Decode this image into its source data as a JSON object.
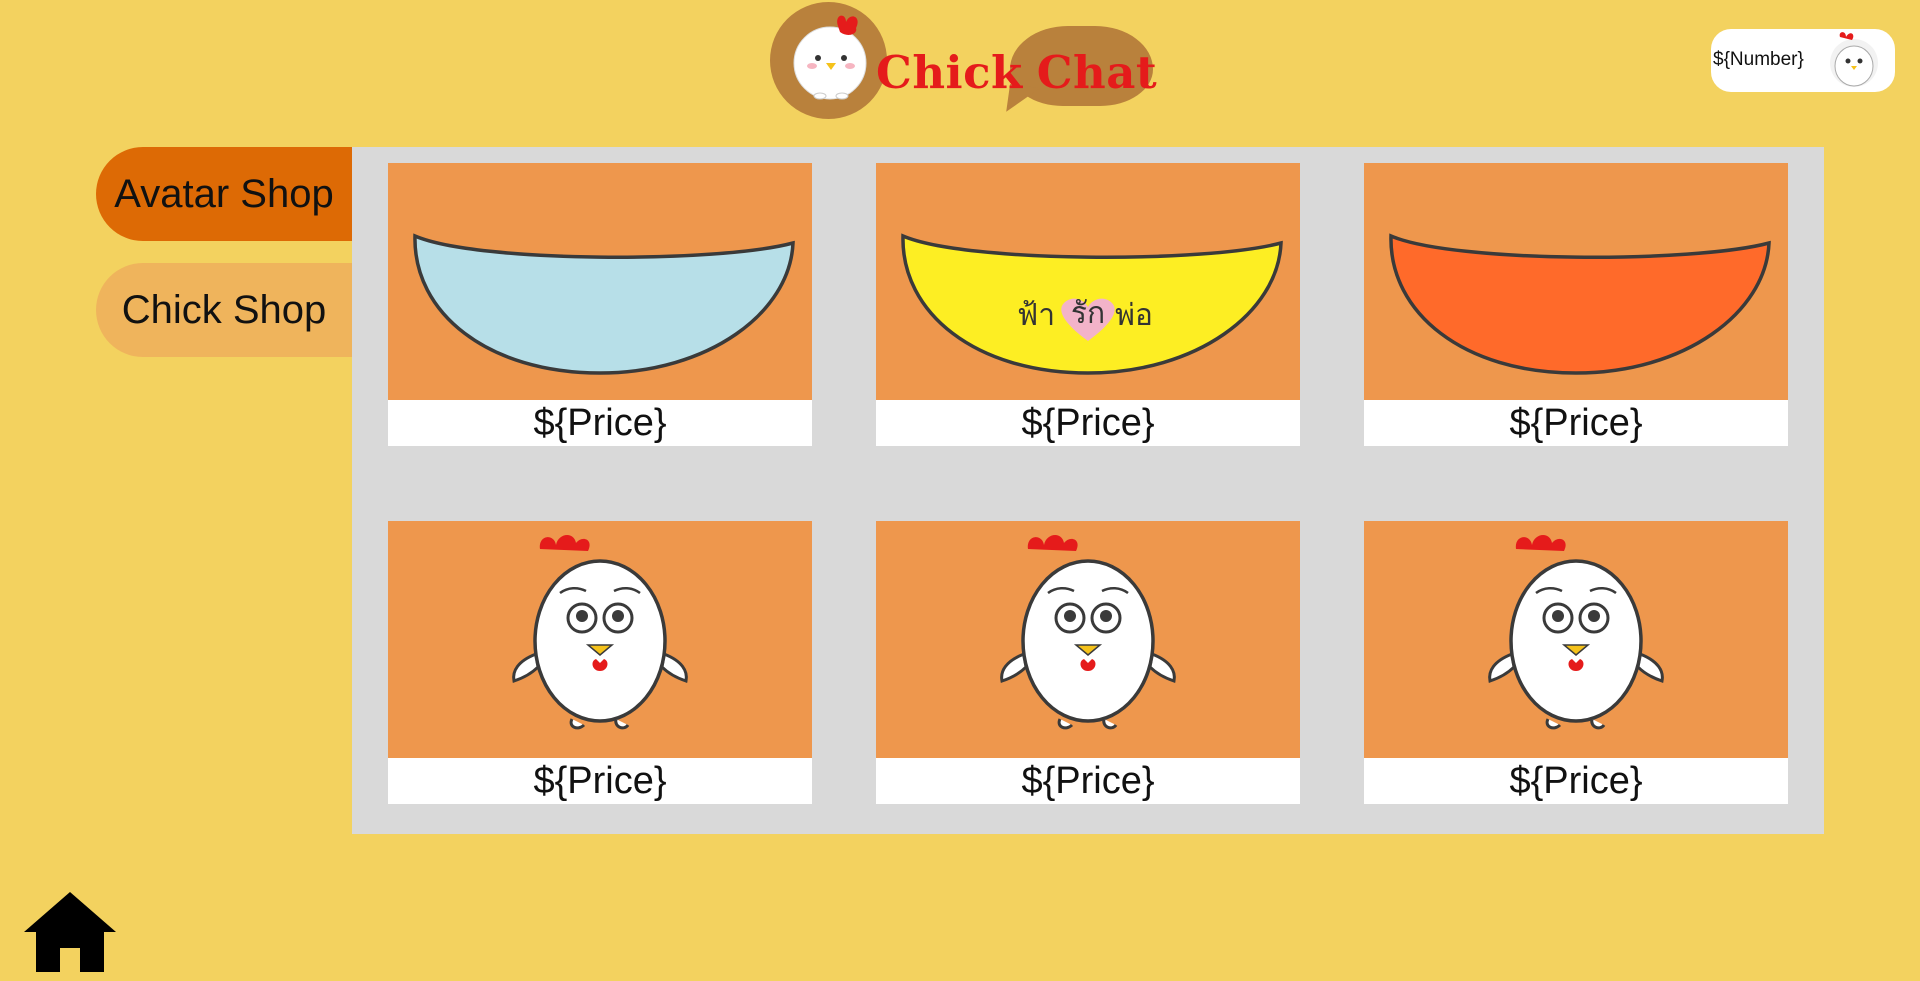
{
  "header": {
    "logo_word_1": "Chick",
    "logo_word_2": "Chat",
    "logo_icon": "chick-logo-icon"
  },
  "user": {
    "number": "${Number}",
    "avatar_icon": "chick-avatar-icon"
  },
  "sidebar": {
    "tabs": [
      {
        "label": "Avatar Shop",
        "active": true
      },
      {
        "label": "Chick Shop",
        "active": false
      }
    ]
  },
  "shop": {
    "items": [
      {
        "item": "light-blue-bowl",
        "price": "${Price}"
      },
      {
        "item": "yellow-bowl",
        "price": "${Price}",
        "bowl_text_1": "ฟ้า",
        "bowl_text_2": "รัก",
        "bowl_text_3": "พ่อ"
      },
      {
        "item": "orange-bowl",
        "price": "${Price}"
      },
      {
        "item": "chick",
        "price": "${Price}"
      },
      {
        "item": "chick",
        "price": "${Price}"
      },
      {
        "item": "chick",
        "price": "${Price}"
      }
    ]
  },
  "colors": {
    "background": "#F3D25F",
    "tab_active": "#DD6A05",
    "tab_inactive": "#EFB45C",
    "panel": "#D9D9D9",
    "card": "#EE974D",
    "logo_brown": "#B9813C",
    "logo_red": "#E51B1B",
    "bowl_blue": "#B7DFE8",
    "bowl_yellow": "#FDEE23",
    "bowl_orange": "#FF6A2A"
  },
  "footer": {
    "home_icon": "home-icon"
  }
}
